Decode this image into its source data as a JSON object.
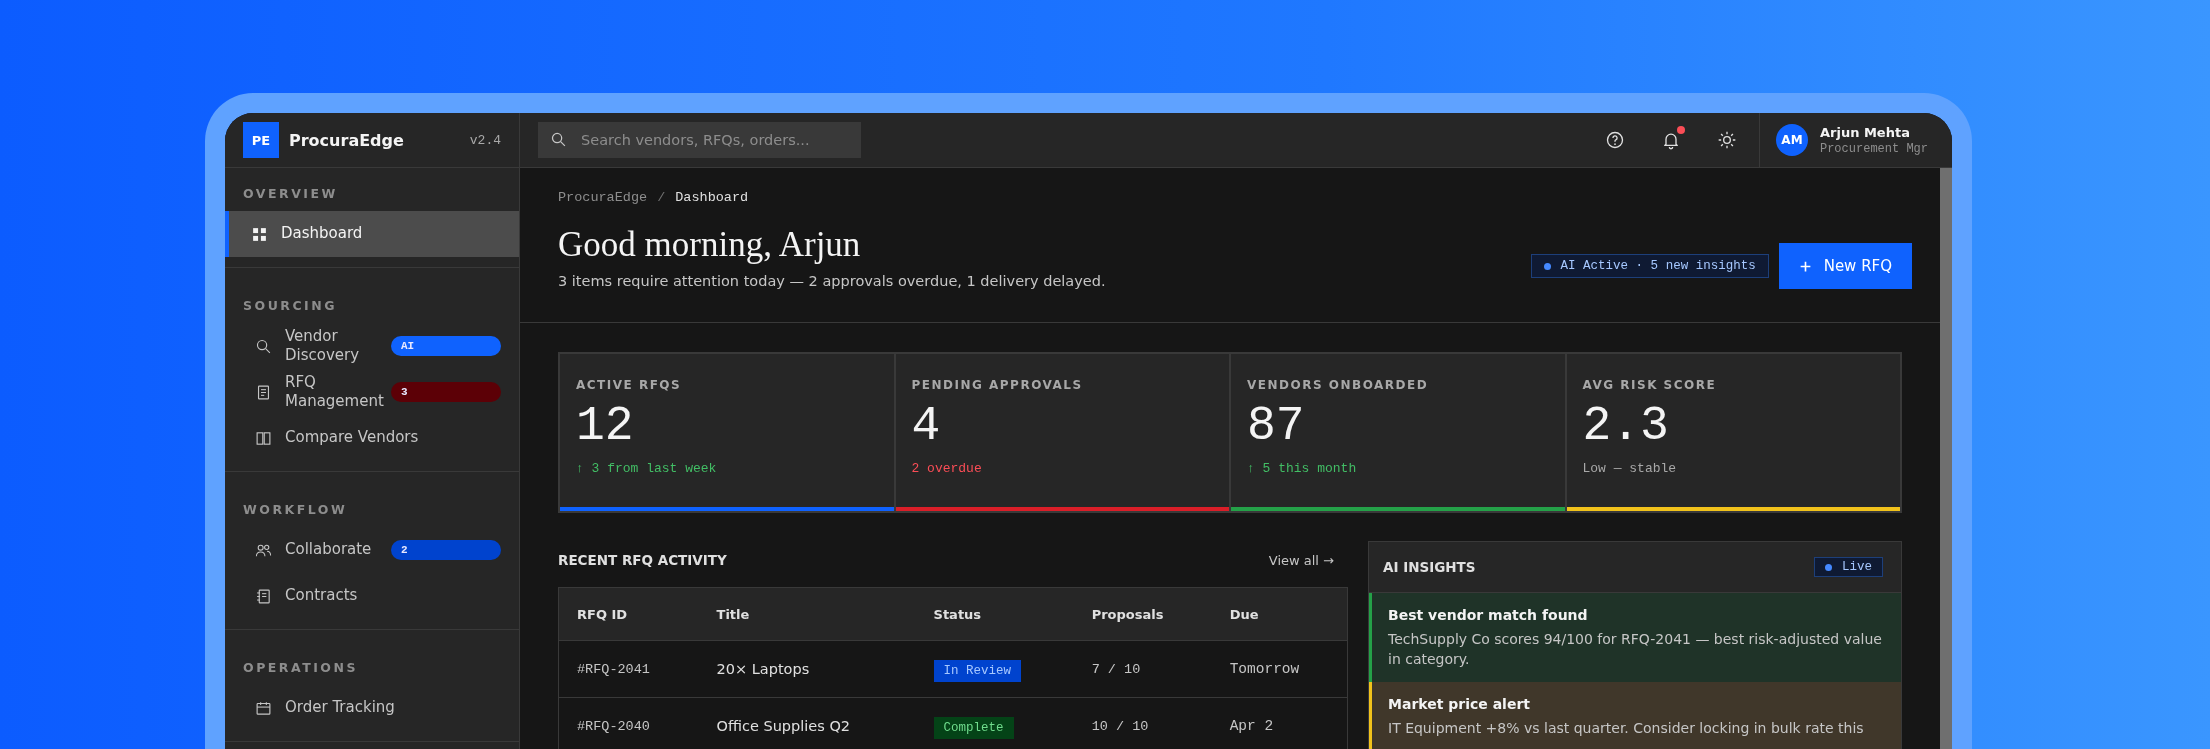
{
  "app": {
    "logo": "PE",
    "name": "ProcuraEdge",
    "version": "v2.4"
  },
  "search": {
    "placeholder": "Search vendors, RFQs, orders..."
  },
  "notifications": {
    "unread": true
  },
  "user": {
    "initials": "AM",
    "name": "Arjun Mehta",
    "role": "Procurement Mgr"
  },
  "sidebar": {
    "sections": [
      {
        "title": "OVERVIEW",
        "items": [
          {
            "label": "Dashboard",
            "selected": true
          }
        ]
      },
      {
        "title": "SOURCING",
        "items": [
          {
            "label": "Vendor Discovery",
            "selected": false,
            "badge": {
              "text": "AI",
              "color": "#0f62fe"
            }
          },
          {
            "label": "RFQ Management",
            "selected": false,
            "badge": {
              "text": "3",
              "color": "#5c0006"
            }
          },
          {
            "label": "Compare Vendors",
            "selected": false
          }
        ]
      },
      {
        "title": "WORKFLOW",
        "items": [
          {
            "label": "Collaborate",
            "selected": false,
            "badge": {
              "text": "2",
              "color": "#0043ce"
            }
          },
          {
            "label": "Contracts",
            "selected": false
          }
        ]
      },
      {
        "title": "OPERATIONS",
        "items": [
          {
            "label": "Order Tracking",
            "selected": false
          }
        ]
      }
    ]
  },
  "breadcrumb": [
    "ProcuraEdge",
    "Dashboard"
  ],
  "breadcrumb_separator": "/",
  "greeting": {
    "title": "Good morning, Arjun",
    "subtitle": "3 items require attention today — 2 approvals overdue, 1 delivery delayed."
  },
  "ai_status": "AI Active · 5 new insights",
  "new_button": "New RFQ",
  "stats": [
    {
      "label": "ACTIVE RFQS",
      "value": "12",
      "note": "↑ 3 from last week",
      "kind": "positive",
      "color": "#0f62fe"
    },
    {
      "label": "PENDING APPROVALS",
      "value": "4",
      "note": "2 overdue",
      "kind": "negative",
      "color": "#da1e28"
    },
    {
      "label": "VENDORS ONBOARDED",
      "value": "87",
      "note": "↑ 5 this month",
      "kind": "positive",
      "color": "#24a148"
    },
    {
      "label": "AVG RISK SCORE",
      "value": "2.3",
      "note": "Low — stable",
      "kind": "neutral",
      "color": "#f1c21b"
    }
  ],
  "recent": {
    "title": "RECENT RFQ ACTIVITY",
    "view_all": "View all →",
    "columns": [
      "RFQ ID",
      "Title",
      "Status",
      "Proposals",
      "Due"
    ],
    "rows": [
      {
        "id": "#RFQ-2041",
        "title": "20× Laptops",
        "status": "In Review",
        "kind": "review",
        "proposals": "7 / 10",
        "due": "Tomorrow"
      },
      {
        "id": "#RFQ-2040",
        "title": "Office Supplies Q2",
        "status": "Complete",
        "kind": "complete",
        "proposals": "10 / 10",
        "due": "Apr 2"
      }
    ]
  },
  "insights": {
    "title": "AI INSIGHTS",
    "live": "Live",
    "items": [
      {
        "kind": "success",
        "title": "Best vendor match found",
        "body": "TechSupply Co scores 94/100 for RFQ-2041 — best risk-adjusted value in category."
      },
      {
        "kind": "warning",
        "title": "Market price alert",
        "body": "IT Equipment +8% vs last quarter. Consider locking in bulk rate this"
      }
    ]
  }
}
